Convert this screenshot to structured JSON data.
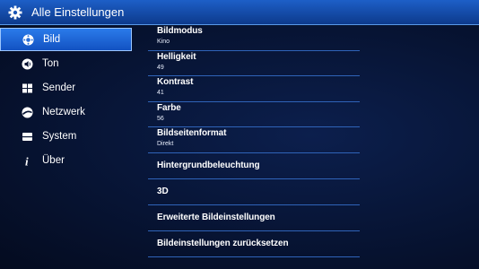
{
  "header": {
    "title": "Alle Einstellungen",
    "icon": "gear-icon"
  },
  "sidebar": {
    "items": [
      {
        "label": "Bild",
        "icon": "picture-settings-icon",
        "active": true
      },
      {
        "label": "Ton",
        "icon": "speaker-icon",
        "active": false
      },
      {
        "label": "Sender",
        "icon": "channel-grid-icon",
        "active": false
      },
      {
        "label": "Netzwerk",
        "icon": "globe-icon",
        "active": false
      },
      {
        "label": "System",
        "icon": "system-icon",
        "active": false
      },
      {
        "label": "Über",
        "icon": "info-icon",
        "active": false
      }
    ]
  },
  "settings": [
    {
      "label": "Bildmodus",
      "value": "Kino"
    },
    {
      "label": "Helligkeit",
      "value": "49"
    },
    {
      "label": "Kontrast",
      "value": "41"
    },
    {
      "label": "Farbe",
      "value": "56"
    },
    {
      "label": "Bildseitenformat",
      "value": "Direkt"
    },
    {
      "label": "Hintergrundbeleuchtung"
    },
    {
      "label": "3D"
    },
    {
      "label": "Erweiterte Bildeinstellungen"
    },
    {
      "label": "Bildeinstellungen zurücksetzen"
    }
  ],
  "colors": {
    "accent": "#1d5fc7",
    "background": "#061028",
    "divider": "#2f63b8"
  }
}
